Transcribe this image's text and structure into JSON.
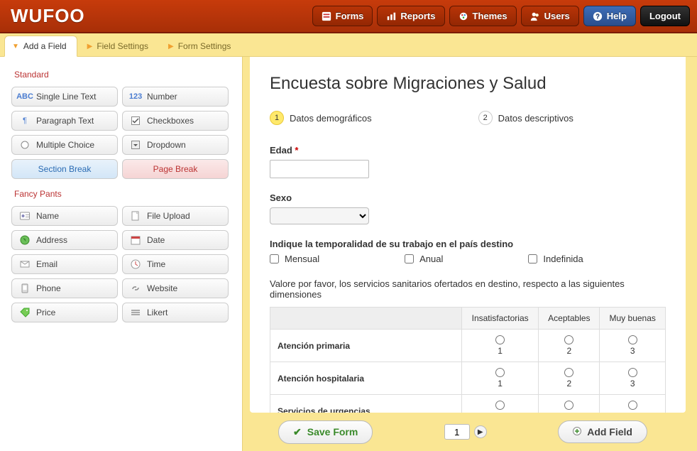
{
  "brand": "WUFOO",
  "topnav": {
    "forms": "Forms",
    "reports": "Reports",
    "themes": "Themes",
    "users": "Users",
    "help": "Help",
    "logout": "Logout"
  },
  "tabs": {
    "add_field": "Add a Field",
    "field_settings": "Field Settings",
    "form_settings": "Form Settings"
  },
  "sections": {
    "standard": "Standard",
    "fancy": "Fancy Pants"
  },
  "fields": {
    "single_line": "Single Line Text",
    "number": "Number",
    "paragraph": "Paragraph Text",
    "checkboxes": "Checkboxes",
    "multiple_choice": "Multiple Choice",
    "dropdown": "Dropdown",
    "section_break": "Section Break",
    "page_break": "Page Break",
    "name": "Name",
    "file_upload": "File Upload",
    "address": "Address",
    "date": "Date",
    "email": "Email",
    "time": "Time",
    "phone": "Phone",
    "website": "Website",
    "price": "Price",
    "likert": "Likert"
  },
  "form": {
    "title": "Encuesta sobre Migraciones y Salud",
    "steps": [
      {
        "num": "1",
        "label": "Datos demográficos"
      },
      {
        "num": "2",
        "label": "Datos descriptivos"
      }
    ],
    "q_edad": {
      "label": "Edad",
      "required": "*"
    },
    "q_sexo": {
      "label": "Sexo"
    },
    "q_temporalidad": {
      "label": "Indique la temporalidad de su trabajo en el país destino",
      "options": [
        "Mensual",
        "Anual",
        "Indefinida"
      ]
    },
    "q_likert": {
      "label": "Valore por favor, los servicios sanitarios ofertados en destino, respecto a las siguientes dimensiones",
      "columns": [
        "Insatisfactorias",
        "Aceptables",
        "Muy buenas"
      ],
      "rows": [
        "Atención primaria",
        "Atención hospitalaria",
        "Servicios de urgencias"
      ],
      "values": [
        "1",
        "2",
        "3"
      ]
    }
  },
  "footer": {
    "save": "Save Form",
    "page": "1",
    "add_field": "Add Field"
  }
}
